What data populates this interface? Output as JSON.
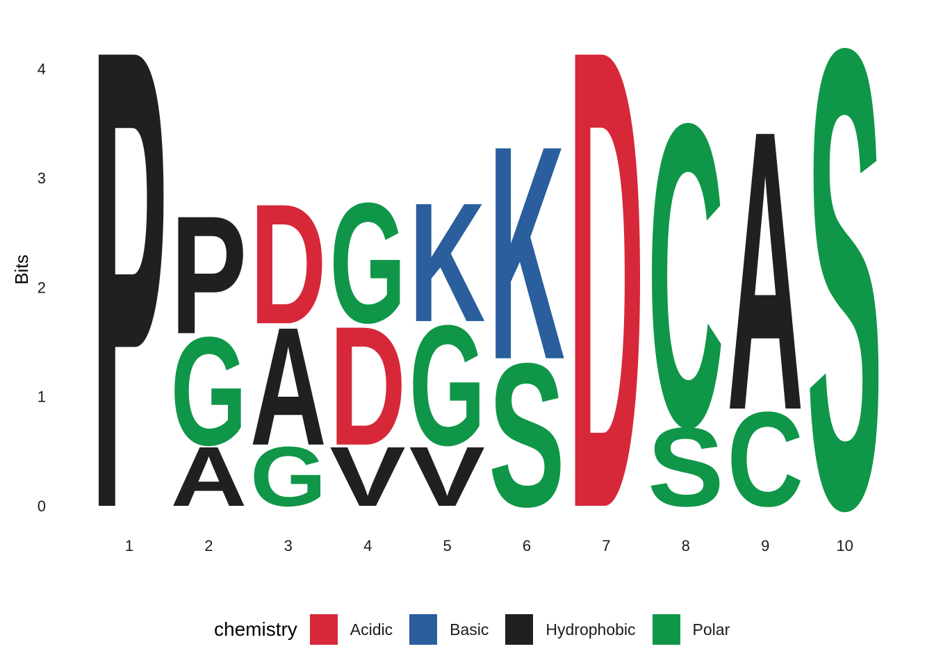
{
  "chart_data": {
    "type": "sequence-logo",
    "title": "",
    "xlabel": "",
    "ylabel": "Bits",
    "ylim": [
      0,
      4.32
    ],
    "y_ticks": [
      "0",
      "1",
      "2",
      "3",
      "4"
    ],
    "x_ticks": [
      "1",
      "2",
      "3",
      "4",
      "5",
      "6",
      "7",
      "8",
      "9",
      "10"
    ],
    "legend_title": "chemistry",
    "legend_position": "bottom",
    "grid": false,
    "colors": {
      "Acidic": "#d62839",
      "Basic": "#2a5e9c",
      "Hydrophobic": "#221f21",
      "Polar": "#109648"
    },
    "legend": [
      {
        "label": "Acidic",
        "color": "#d62839"
      },
      {
        "label": "Basic",
        "color": "#2a5e9c"
      },
      {
        "label": "Hydrophobic",
        "color": "#221f21"
      },
      {
        "label": "Polar",
        "color": "#109648"
      }
    ],
    "positions": [
      {
        "position": 1,
        "stack": [
          {
            "letter": "P",
            "chemistry": "Hydrophobic",
            "height": 4.32
          }
        ]
      },
      {
        "position": 2,
        "stack": [
          {
            "letter": "A",
            "chemistry": "Hydrophobic",
            "height": 0.56
          },
          {
            "letter": "G",
            "chemistry": "Polar",
            "height": 1.02
          },
          {
            "letter": "P",
            "chemistry": "Hydrophobic",
            "height": 1.11
          }
        ]
      },
      {
        "position": 3,
        "stack": [
          {
            "letter": "G",
            "chemistry": "Polar",
            "height": 0.56
          },
          {
            "letter": "A",
            "chemistry": "Hydrophobic",
            "height": 1.11
          },
          {
            "letter": "D",
            "chemistry": "Acidic",
            "height": 1.13
          }
        ]
      },
      {
        "position": 4,
        "stack": [
          {
            "letter": "V",
            "chemistry": "Hydrophobic",
            "height": 0.56
          },
          {
            "letter": "D",
            "chemistry": "Acidic",
            "height": 1.12
          },
          {
            "letter": "G",
            "chemistry": "Polar",
            "height": 1.13
          }
        ]
      },
      {
        "position": 5,
        "stack": [
          {
            "letter": "V",
            "chemistry": "Hydrophobic",
            "height": 0.56
          },
          {
            "letter": "G",
            "chemistry": "Polar",
            "height": 1.13
          },
          {
            "letter": "K",
            "chemistry": "Basic",
            "height": 1.12
          }
        ]
      },
      {
        "position": 6,
        "stack": [
          {
            "letter": "S",
            "chemistry": "Polar",
            "height": 1.35
          },
          {
            "letter": "K",
            "chemistry": "Basic",
            "height": 2.01
          }
        ]
      },
      {
        "position": 7,
        "stack": [
          {
            "letter": "D",
            "chemistry": "Acidic",
            "height": 4.32
          }
        ]
      },
      {
        "position": 8,
        "stack": [
          {
            "letter": "S",
            "chemistry": "Polar",
            "height": 0.74
          },
          {
            "letter": "C",
            "chemistry": "Polar",
            "height": 2.85
          }
        ]
      },
      {
        "position": 9,
        "stack": [
          {
            "letter": "C",
            "chemistry": "Polar",
            "height": 0.89
          },
          {
            "letter": "A",
            "chemistry": "Hydrophobic",
            "height": 2.63
          }
        ]
      },
      {
        "position": 10,
        "stack": [
          {
            "letter": "S",
            "chemistry": "Polar",
            "height": 4.32
          }
        ]
      }
    ]
  }
}
